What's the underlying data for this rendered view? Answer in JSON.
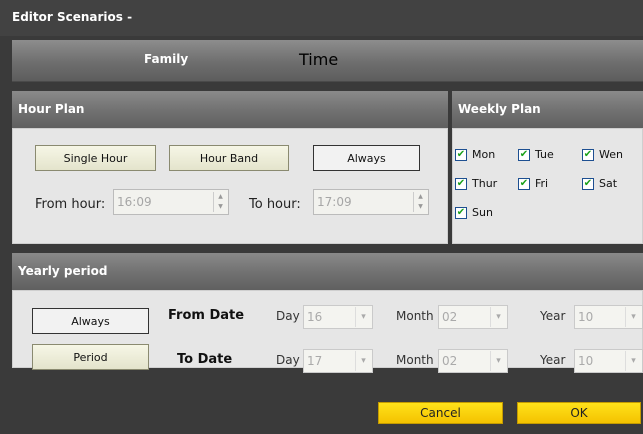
{
  "window": {
    "title": "Editor Scenarios -"
  },
  "tabs": [
    {
      "label": "Family"
    },
    {
      "label": "Time"
    }
  ],
  "hour_plan": {
    "header": "Hour Plan",
    "single_hour_label": "Single Hour",
    "hour_band_label": "Hour Band",
    "always_label": "Always",
    "selected": "Always",
    "from_label": "From hour:",
    "from_value": "16:09",
    "to_label": "To hour:",
    "to_value": "17:09"
  },
  "weekly_plan": {
    "header": "Weekly Plan",
    "days": [
      {
        "label": "Mon",
        "checked": true
      },
      {
        "label": "Tue",
        "checked": true
      },
      {
        "label": "Wen",
        "checked": true
      },
      {
        "label": "Thur",
        "checked": true
      },
      {
        "label": "Fri",
        "checked": true
      },
      {
        "label": "Sat",
        "checked": true
      },
      {
        "label": "Sun",
        "checked": true
      }
    ]
  },
  "yearly_period": {
    "header": "Yearly period",
    "always_label": "Always",
    "period_label": "Period",
    "selected": "Always",
    "from_date_label": "From Date",
    "to_date_label": "To Date",
    "day_label": "Day",
    "month_label": "Month",
    "year_label": "Year",
    "from": {
      "day": "16",
      "month": "02",
      "year": "10"
    },
    "to": {
      "day": "17",
      "month": "02",
      "year": "10"
    }
  },
  "footer": {
    "cancel_label": "Cancel",
    "ok_label": "OK"
  },
  "colors": {
    "footer_button": "#f7cc00",
    "checkmark": "#1aa01a",
    "title_bar": "#424242"
  },
  "icons": {
    "checkbox_checked": "check-icon",
    "spin_up": "spin-up-icon",
    "spin_down": "spin-down-icon",
    "dropdown": "chevron-down-icon"
  }
}
